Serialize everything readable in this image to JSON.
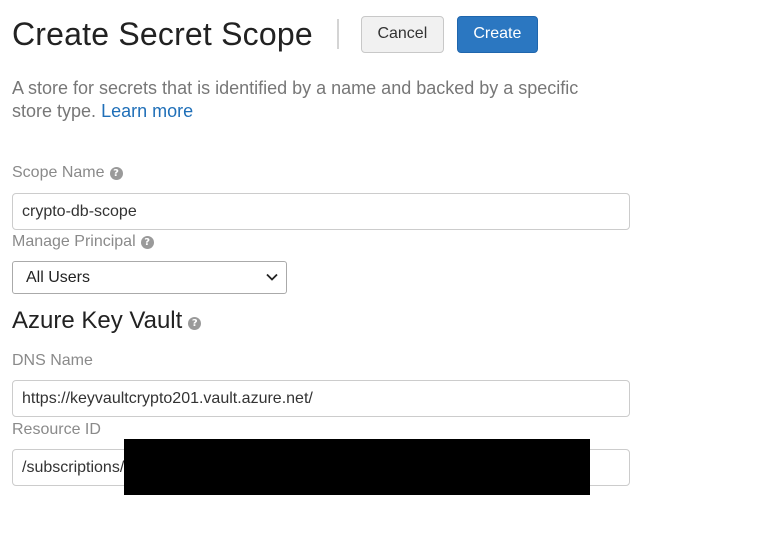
{
  "header": {
    "title": "Create Secret Scope",
    "cancel_label": "Cancel",
    "create_label": "Create"
  },
  "description": {
    "text": "A store for secrets that is identified by a name and backed by a specific store type.",
    "link_text": "Learn more"
  },
  "form": {
    "scope_name": {
      "label": "Scope Name",
      "value": "crypto-db-scope"
    },
    "manage_principal": {
      "label": "Manage Principal",
      "selected": "All Users"
    },
    "azure_key_vault": {
      "title": "Azure Key Vault",
      "dns_name": {
        "label": "DNS Name",
        "value": "https://keyvaultcrypto201.vault.azure.net/"
      },
      "resource_id": {
        "label": "Resource ID",
        "value": "/subscriptions/                                                                                          /provid"
      }
    }
  },
  "icons": {
    "help": "question-circle-icon",
    "select_arrow": "chevron-down-icon"
  },
  "colors": {
    "primary": "#2b77c1",
    "link": "#1f6fb8",
    "label": "#8a8a8a",
    "redaction": "#000000"
  }
}
